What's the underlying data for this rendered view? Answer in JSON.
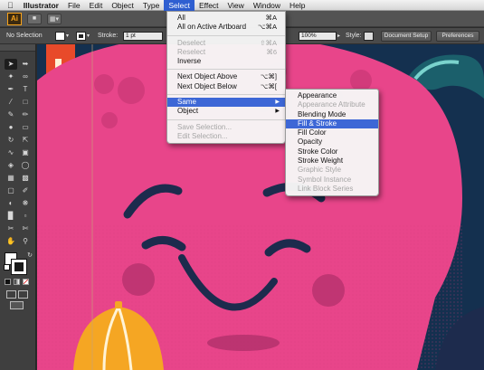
{
  "menubar": {
    "apple": "",
    "items": [
      "Illustrator",
      "File",
      "Edit",
      "Object",
      "Type",
      "Select",
      "Effect",
      "View",
      "Window",
      "Help"
    ],
    "active": "Select"
  },
  "appbar": {
    "logo": "Ai"
  },
  "controlbar": {
    "selection": "No Selection",
    "stroke_label": "Stroke:",
    "stroke_value": "1 pt",
    "opacity_value": "100%",
    "style_label": "Style:",
    "document_setup": "Document Setup",
    "preferences": "Preferences"
  },
  "select_menu": {
    "items": [
      {
        "label": "All",
        "shortcut": "⌘A",
        "disabled": false
      },
      {
        "label": "All on Active Artboard",
        "shortcut": "⌥⌘A",
        "disabled": false
      },
      {
        "label": "Deselect",
        "shortcut": "⇧⌘A",
        "disabled": true
      },
      {
        "label": "Reselect",
        "shortcut": "⌘6",
        "disabled": true
      },
      {
        "label": "Inverse",
        "shortcut": "",
        "disabled": false
      },
      {
        "label": "Next Object Above",
        "shortcut": "⌥⌘]",
        "disabled": false
      },
      {
        "label": "Next Object Below",
        "shortcut": "⌥⌘[",
        "disabled": false
      },
      {
        "label": "Same",
        "shortcut": "",
        "disabled": false,
        "submenu": true,
        "highlighted": true
      },
      {
        "label": "Object",
        "shortcut": "",
        "disabled": false,
        "submenu": true
      },
      {
        "label": "Save Selection...",
        "shortcut": "",
        "disabled": true
      },
      {
        "label": "Edit Selection...",
        "shortcut": "",
        "disabled": true
      }
    ]
  },
  "same_menu": {
    "items": [
      {
        "label": "Appearance",
        "disabled": false
      },
      {
        "label": "Appearance Attribute",
        "disabled": true
      },
      {
        "label": "Blending Mode",
        "disabled": false
      },
      {
        "label": "Fill & Stroke",
        "disabled": false,
        "highlighted": true
      },
      {
        "label": "Fill Color",
        "disabled": false
      },
      {
        "label": "Opacity",
        "disabled": false
      },
      {
        "label": "Stroke Color",
        "disabled": false
      },
      {
        "label": "Stroke Weight",
        "disabled": false
      },
      {
        "label": "Graphic Style",
        "disabled": true
      },
      {
        "label": "Symbol Instance",
        "disabled": true
      },
      {
        "label": "Link Block Series",
        "disabled": true
      }
    ]
  },
  "colors": {
    "character_pink": "#e8458a",
    "background_navy": "#14304f",
    "accent_orange": "#f5a623",
    "menu_highlight": "#3d67d6"
  }
}
